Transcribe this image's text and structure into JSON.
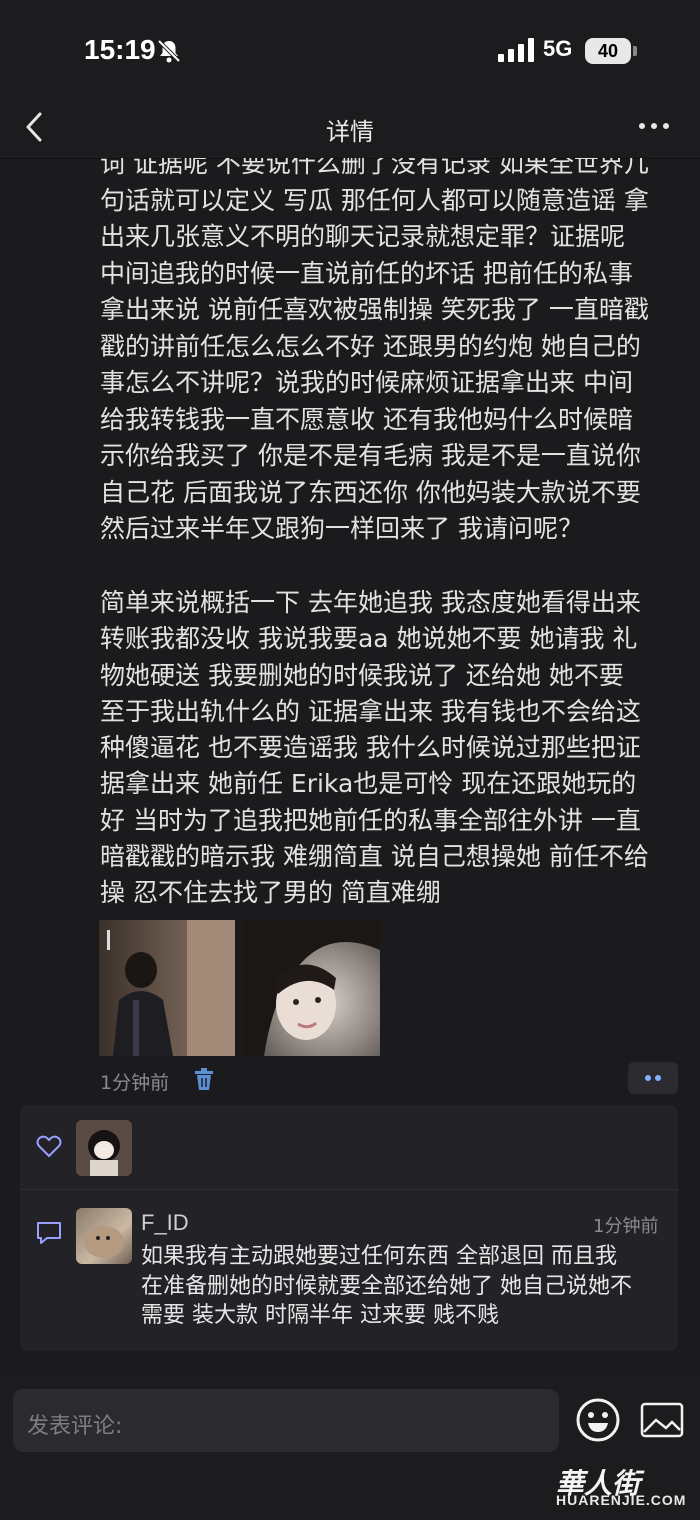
{
  "status_bar": {
    "time": "15:19",
    "network": "5G",
    "battery": "40"
  },
  "nav": {
    "title": "详情"
  },
  "post": {
    "paragraph1": "词 证据呢 不要说什么删了没有记录 如果全世界几\n句话就可以定义 写瓜 那任何人都可以随意造谣 拿\n出来几张意义不明的聊天记录就想定罪？证据呢\n中间追我的时候一直说前任的坏话 把前任的私事\n拿出来说 说前任喜欢被强制操 笑死我了 一直暗戳\n戳的讲前任怎么怎么不好 还跟男的约炮 她自己的\n事怎么不讲呢？说我的时候麻烦证据拿出来 中间\n给我转钱我一直不愿意收 还有我他妈什么时候暗\n示你给我买了 你是不是有毛病 我是不是一直说你\n自己花 后面我说了东西还你 你他妈装大款说不要\n然后过来半年又跟狗一样回来了 我请问呢？",
    "paragraph2": "简单来说概括一下 去年她追我 我态度她看得出来\n转账我都没收 我说我要aa 她说她不要 她请我 礼\n物她硬送 我要删她的时候我说了 还给她 她不要\n至于我出轨什么的 证据拿出来 我有钱也不会给这\n种傻逼花 也不要造谣我 我什么时候说过那些把证\n据拿出来  她前任 Erika也是可怜 现在还跟她玩的\n好 当时为了追我把她前任的私事全部往外讲 一直\n暗戳戳的暗示我 难绷简直 说自己想操她 前任不给\n操 忍不住去找了男的 简直难绷",
    "time": "1分钟前"
  },
  "comment": {
    "name": "F_ID",
    "time": "1分钟前",
    "text": "如果我有主动跟她要过任何东西 全部退回 而且我\n在准备删她的时候就要全部还给她了 她自己说她不\n需要 装大款 时隔半年 过来要 贱不贱"
  },
  "composer": {
    "placeholder": "发表评论:"
  },
  "watermark": {
    "logo_text": "華人街",
    "text": "HUARENJIE.COM"
  }
}
